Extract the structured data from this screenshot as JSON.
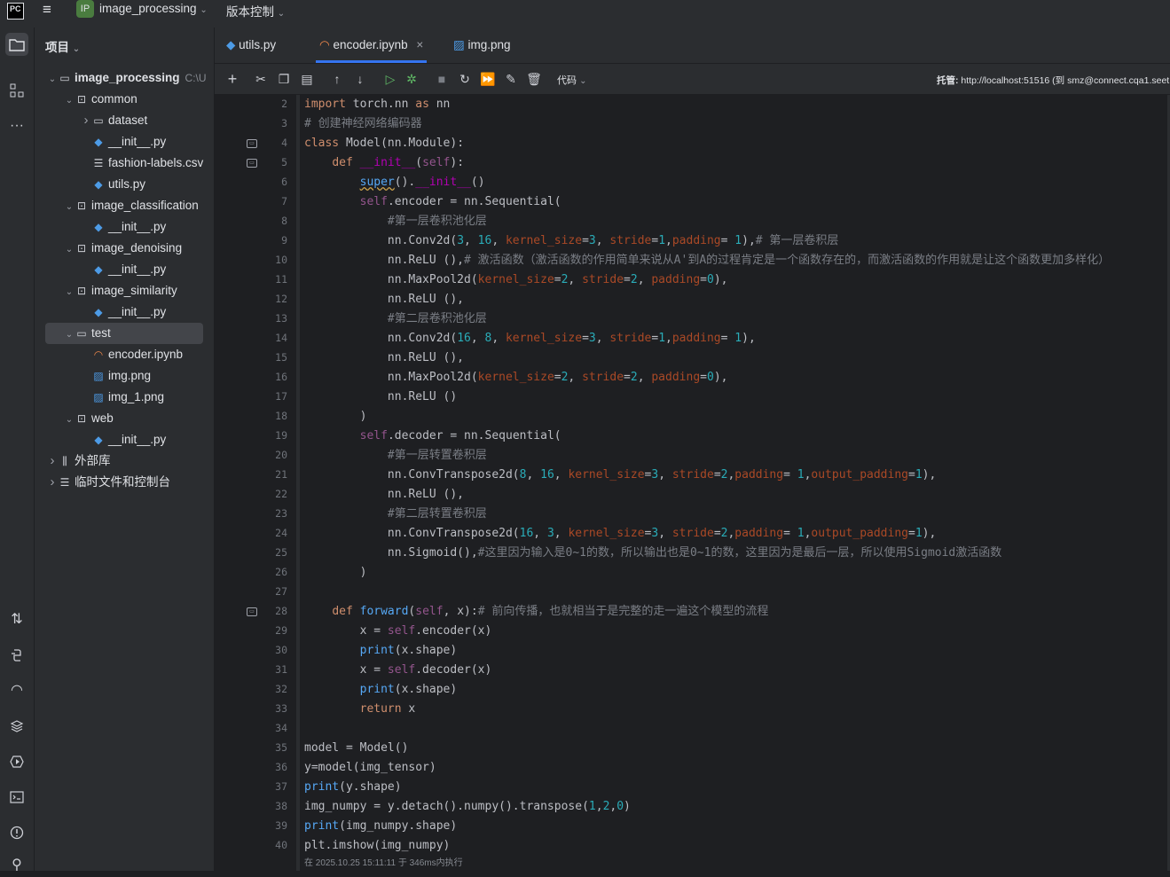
{
  "titlebar": {
    "logo": "PC",
    "project_badge": "IP",
    "project_name": "image_processing",
    "vcs_menu": "版本控制"
  },
  "project_panel": {
    "header": "项目",
    "tree": [
      {
        "label": "image_processing",
        "extra": "C:\\U",
        "indent": 0,
        "chev": "v",
        "icon": "folder",
        "bold": true
      },
      {
        "label": "common",
        "indent": 1,
        "chev": "v",
        "icon": "package"
      },
      {
        "label": "dataset",
        "indent": 2,
        "chev": ">",
        "icon": "folder"
      },
      {
        "label": "__init__.py",
        "indent": 2,
        "chev": "",
        "icon": "python"
      },
      {
        "label": "fashion-labels.csv",
        "indent": 2,
        "chev": "",
        "icon": "text"
      },
      {
        "label": "utils.py",
        "indent": 2,
        "chev": "",
        "icon": "python"
      },
      {
        "label": "image_classification",
        "indent": 1,
        "chev": "v",
        "icon": "package"
      },
      {
        "label": "__init__.py",
        "indent": 2,
        "chev": "",
        "icon": "python"
      },
      {
        "label": "image_denoising",
        "indent": 1,
        "chev": "v",
        "icon": "package"
      },
      {
        "label": "__init__.py",
        "indent": 2,
        "chev": "",
        "icon": "python"
      },
      {
        "label": "image_similarity",
        "indent": 1,
        "chev": "v",
        "icon": "package"
      },
      {
        "label": "__init__.py",
        "indent": 2,
        "chev": "",
        "icon": "python"
      },
      {
        "label": "test",
        "indent": 1,
        "chev": "v",
        "icon": "folder",
        "selected": true
      },
      {
        "label": "encoder.ipynb",
        "indent": 2,
        "chev": "",
        "icon": "notebook"
      },
      {
        "label": "img.png",
        "indent": 2,
        "chev": "",
        "icon": "image"
      },
      {
        "label": "img_1.png",
        "indent": 2,
        "chev": "",
        "icon": "image"
      },
      {
        "label": "web",
        "indent": 1,
        "chev": "v",
        "icon": "package"
      },
      {
        "label": "__init__.py",
        "indent": 2,
        "chev": "",
        "icon": "python"
      },
      {
        "label": "外部库",
        "indent": 0,
        "chev": ">",
        "icon": "library"
      },
      {
        "label": "临时文件和控制台",
        "indent": 0,
        "chev": ">",
        "icon": "scratch"
      }
    ]
  },
  "tabs": [
    {
      "label": "utils.py",
      "icon": "python"
    },
    {
      "label": "encoder.ipynb",
      "icon": "notebook",
      "active": true,
      "close": "×"
    },
    {
      "label": "img.png",
      "icon": "image"
    }
  ],
  "toolbar": {
    "kernel_label": "代码",
    "host_label": "托管:",
    "host_url": "http://localhost:51516 (到 smz@connect.cqa1.seet"
  },
  "gutter_icons_lines": [
    4,
    5,
    28
  ],
  "code_lines": [
    {
      "n": "2",
      "html": "<span class='kw'>import</span> torch.nn <span class='kw'>as</span> nn"
    },
    {
      "n": "3",
      "html": "<span class='cm'># 创建神经网络编码器</span>"
    },
    {
      "n": "4",
      "html": "<span class='kw'>class</span> Model(nn.Module):"
    },
    {
      "n": "5",
      "html": "    <span class='kw'>def</span> <span class='dnd'>__init__</span>(<span class='slf'>self</span>):"
    },
    {
      "n": "6",
      "html": "        <span class='sup'>super</span>().<span class='dnd'>__init__</span>()"
    },
    {
      "n": "7",
      "html": "        <span class='slf'>self</span>.encoder = nn.Sequential("
    },
    {
      "n": "8",
      "html": "            <span class='cm'>#第一层卷积池化层</span>"
    },
    {
      "n": "9",
      "html": "            nn.Conv2d(<span class='num'>3</span>, <span class='num'>16</span>, <span class='par'>kernel_size</span>=<span class='num'>3</span>, <span class='par'>stride</span>=<span class='num'>1</span>,<span class='par'>padding</span>= <span class='num'>1</span>),<span class='cm'># 第一层卷积层</span>"
    },
    {
      "n": "10",
      "html": "            nn.ReLU (),<span class='cm'># 激活函数（激活函数的作用简单来说从A'到A的过程肯定是一个函数存在的，而激活函数的作用就是让这个函数更加多样化）</span>"
    },
    {
      "n": "11",
      "html": "            nn.MaxPool2d(<span class='par'>kernel_size</span>=<span class='num'>2</span>, <span class='par'>stride</span>=<span class='num'>2</span>, <span class='par'>padding</span>=<span class='num'>0</span>),"
    },
    {
      "n": "12",
      "html": "            nn.ReLU (),"
    },
    {
      "n": "13",
      "html": "            <span class='cm'>#第二层卷积池化层</span>"
    },
    {
      "n": "14",
      "html": "            nn.Conv2d(<span class='num'>16</span>, <span class='num'>8</span>, <span class='par'>kernel_size</span>=<span class='num'>3</span>, <span class='par'>stride</span>=<span class='num'>1</span>,<span class='par'>padding</span>= <span class='num'>1</span>),"
    },
    {
      "n": "15",
      "html": "            nn.ReLU (),"
    },
    {
      "n": "16",
      "html": "            nn.MaxPool2d(<span class='par'>kernel_size</span>=<span class='num'>2</span>, <span class='par'>stride</span>=<span class='num'>2</span>, <span class='par'>padding</span>=<span class='num'>0</span>),"
    },
    {
      "n": "17",
      "html": "            nn.ReLU ()"
    },
    {
      "n": "18",
      "html": "        )"
    },
    {
      "n": "19",
      "html": "        <span class='slf'>self</span>.decoder = nn.Sequential("
    },
    {
      "n": "20",
      "html": "            <span class='cm'>#第一层转置卷积层</span>"
    },
    {
      "n": "21",
      "html": "            nn.ConvTranspose2d(<span class='num'>8</span>, <span class='num'>16</span>, <span class='par'>kernel_size</span>=<span class='num'>3</span>, <span class='par'>stride</span>=<span class='num'>2</span>,<span class='par'>padding</span>= <span class='num'>1</span>,<span class='par'>output_padding</span>=<span class='num'>1</span>),"
    },
    {
      "n": "22",
      "html": "            nn.ReLU (),"
    },
    {
      "n": "23",
      "html": "            <span class='cm'>#第二层转置卷积层</span>"
    },
    {
      "n": "24",
      "html": "            nn.ConvTranspose2d(<span class='num'>16</span>, <span class='num'>3</span>, <span class='par'>kernel_size</span>=<span class='num'>3</span>, <span class='par'>stride</span>=<span class='num'>2</span>,<span class='par'>padding</span>= <span class='num'>1</span>,<span class='par'>output_padding</span>=<span class='num'>1</span>),"
    },
    {
      "n": "25",
      "html": "            nn.Sigmoid(),<span class='cm'>#这里因为输入是0~1的数，所以输出也是0~1的数，这里因为是最后一层，所以使用Sigmoid激活函数</span>"
    },
    {
      "n": "26",
      "html": "        )"
    },
    {
      "n": "27",
      "html": ""
    },
    {
      "n": "28",
      "html": "    <span class='kw'>def</span> <span class='fn'>forward</span>(<span class='slf'>self</span>, x):<span class='cm'># 前向传播，也就相当于是完整的走一遍这个模型的流程</span>"
    },
    {
      "n": "29",
      "html": "        x = <span class='slf'>self</span>.encoder(x)"
    },
    {
      "n": "30",
      "html": "        <span class='bi'>print</span>(x.shape)"
    },
    {
      "n": "31",
      "html": "        x = <span class='slf'>self</span>.decoder(x)"
    },
    {
      "n": "32",
      "html": "        <span class='bi'>print</span>(x.shape)"
    },
    {
      "n": "33",
      "html": "        <span class='kw'>return</span> x"
    },
    {
      "n": "34",
      "html": ""
    },
    {
      "n": "35",
      "html": "model = Model()"
    },
    {
      "n": "36",
      "html": "y=model(img_tensor)"
    },
    {
      "n": "37",
      "html": "<span class='bi'>print</span>(y.shape)"
    },
    {
      "n": "38",
      "html": "img_numpy = y.detach().numpy().transpose(<span class='num'>1</span>,<span class='num'>2</span>,<span class='num'>0</span>)"
    },
    {
      "n": "39",
      "html": "<span class='bi'>print</span>(img_numpy.shape)"
    },
    {
      "n": "40",
      "html": "plt.imshow(img_numpy)"
    }
  ],
  "status": "在 2025.10.25 15:11:11 于 346ms内执行"
}
